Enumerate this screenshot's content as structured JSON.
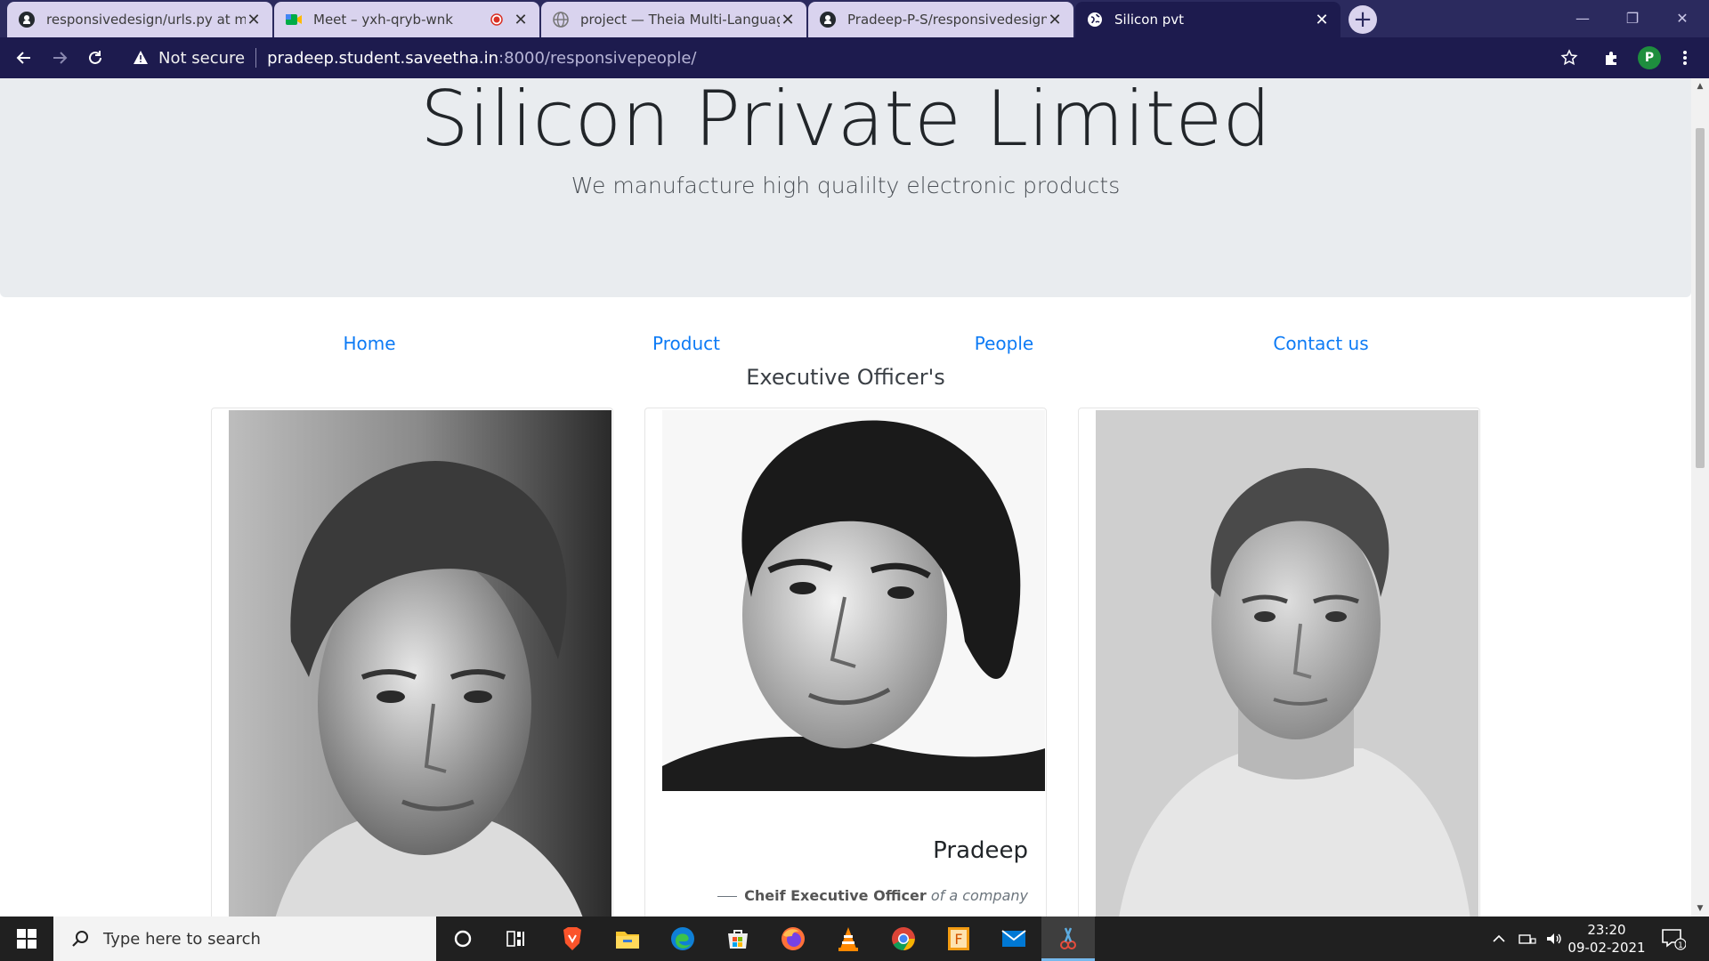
{
  "browser": {
    "tabs": [
      {
        "title": "responsivedesign/urls.py at mast",
        "icon": "github-icon"
      },
      {
        "title": "Meet – yxh-qryb-wnk",
        "icon": "google-meet-icon"
      },
      {
        "title": "project — Theia Multi-Language",
        "icon": "globe-icon"
      },
      {
        "title": "Pradeep-P-S/responsivedesign",
        "icon": "github-icon"
      },
      {
        "title": "Silicon pvt",
        "icon": "globe-icon",
        "active": true
      }
    ],
    "security_label": "Not secure",
    "url_host": "pradeep.student.saveetha.in",
    "url_path": ":8000/responsivepeople/",
    "profile_initial": "P"
  },
  "page": {
    "title": "Silicon Private Limited",
    "subtitle": "We manufacture high qualilty electronic products",
    "nav": [
      "Home",
      "Product",
      "People",
      "Contact us"
    ],
    "section_title": "Executive Officer's",
    "cards": [
      {
        "photo": "portrait-1",
        "name": "",
        "role": "",
        "role_suffix": ""
      },
      {
        "photo": "portrait-2",
        "name": "Pradeep",
        "role": "Cheif Executive Officer",
        "role_suffix": "of a company"
      },
      {
        "photo": "portrait-3",
        "name": "",
        "role": "",
        "role_suffix": ""
      }
    ],
    "colors": {
      "jumbotron": "#e9ecef",
      "link": "#0d7bf5"
    }
  },
  "taskbar": {
    "search_placeholder": "Type here to search",
    "time": "23:20",
    "date": "09-02-2021",
    "notification_count": "1"
  }
}
